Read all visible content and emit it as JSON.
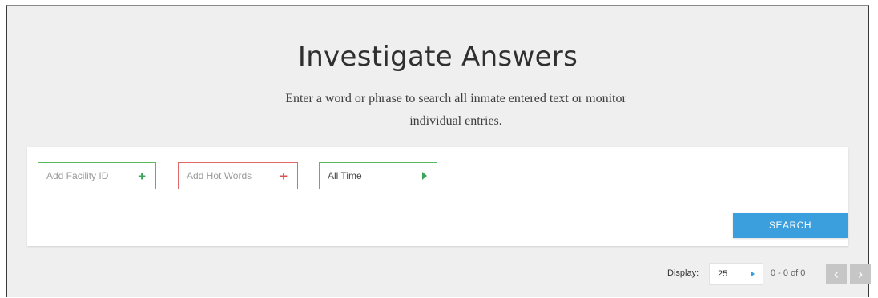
{
  "page": {
    "title": "Investigate Answers",
    "subtitle_line1": "Enter a word or phrase to search all inmate entered text or monitor",
    "subtitle_line2": "individual entries."
  },
  "filters": {
    "facility_placeholder": "Add Facility ID",
    "hot_words_placeholder": "Add Hot Words",
    "time_range_value": "All Time"
  },
  "actions": {
    "search_label": "SEARCH"
  },
  "pagination": {
    "display_label": "Display:",
    "display_value": "25",
    "range_text": "0 - 0 of 0",
    "prev_glyph": "‹",
    "next_glyph": "›"
  },
  "colors": {
    "accent_blue": "#3a9fdc",
    "success_green": "#3aa55a",
    "danger_red": "#d9534f",
    "background": "#efefef"
  },
  "icons": {
    "facility_add": "plus-icon",
    "hot_words_add": "plus-icon",
    "time_range": "caret-right-icon",
    "display_select": "caret-right-icon",
    "prev": "chevron-left-icon",
    "next": "chevron-right-icon"
  }
}
